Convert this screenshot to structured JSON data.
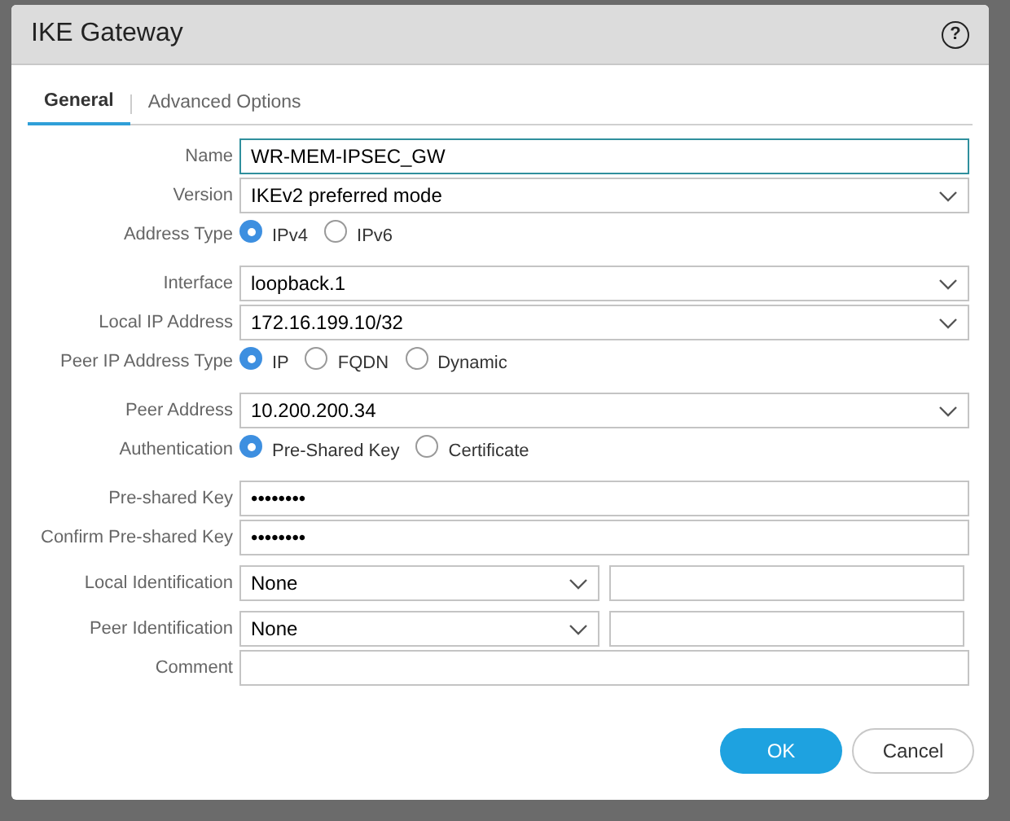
{
  "window": {
    "title": "IKE Gateway",
    "help": "?"
  },
  "tabs": [
    {
      "label": "General",
      "selected": true
    },
    {
      "label": "Advanced Options",
      "selected": false
    }
  ],
  "fields": [
    {
      "kind": "text",
      "label": "Name",
      "value": "WR-MEM-IPSEC_GW",
      "focused": true
    },
    {
      "kind": "select",
      "label": "Version",
      "value": "IKEv2 preferred mode"
    },
    {
      "kind": "radio",
      "label": "Address Type",
      "options": [
        {
          "label": "IPv4",
          "selected": true
        },
        {
          "label": "IPv6",
          "selected": false
        }
      ]
    },
    {
      "kind": "select",
      "label": "Interface",
      "value": "loopback.1"
    },
    {
      "kind": "select",
      "label": "Local IP Address",
      "value": "172.16.199.10/32"
    },
    {
      "kind": "radio",
      "label": "Peer IP Address Type",
      "options": [
        {
          "label": "IP",
          "selected": true
        },
        {
          "label": "FQDN",
          "selected": false
        },
        {
          "label": "Dynamic",
          "selected": false
        }
      ]
    },
    {
      "kind": "select",
      "label": "Peer Address",
      "value": "10.200.200.34"
    },
    {
      "kind": "radio",
      "label": "Authentication",
      "options": [
        {
          "label": "Pre-Shared Key",
          "selected": true
        },
        {
          "label": "Certificate",
          "selected": false
        }
      ]
    },
    {
      "kind": "text",
      "label": "Pre-shared Key",
      "value": "••••••••",
      "focused": false
    },
    {
      "kind": "text",
      "label": "Confirm Pre-shared Key",
      "value": "••••••••",
      "focused": false
    },
    {
      "kind": "pair",
      "label": "Local Identification",
      "value": "None"
    },
    {
      "kind": "pair",
      "label": "Peer Identification",
      "value": "None"
    },
    {
      "kind": "text",
      "label": "Comment",
      "focused": false
    }
  ],
  "buttons": [
    {
      "label": "OK",
      "kind": "primary"
    },
    {
      "label": "Cancel",
      "kind": "secondary"
    }
  ]
}
